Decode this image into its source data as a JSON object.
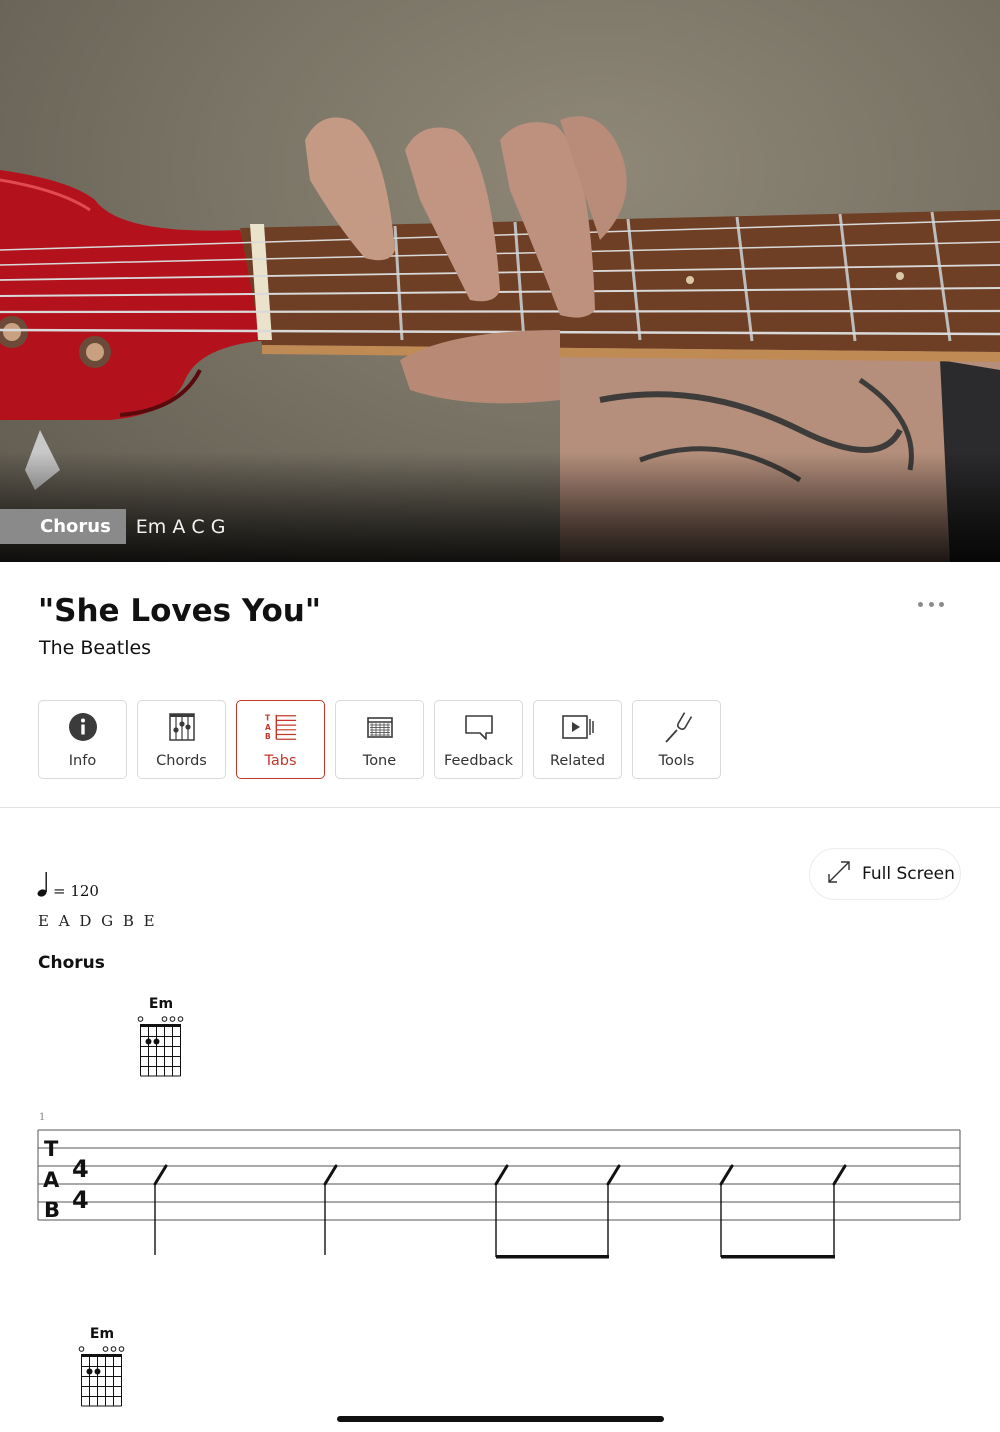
{
  "video": {
    "section_label": "Chorus",
    "section_chords": "Em A C G"
  },
  "song": {
    "title": "\"She Loves You\"",
    "artist": "The Beatles"
  },
  "toolbar": {
    "more_icon": "ellipsis-icon",
    "tabs": [
      {
        "label": "Info",
        "icon": "info-icon",
        "active": false
      },
      {
        "label": "Chords",
        "icon": "chord-grid-icon",
        "active": false
      },
      {
        "label": "Tabs",
        "icon": "tab-icon",
        "active": true
      },
      {
        "label": "Tone",
        "icon": "amp-icon",
        "active": false
      },
      {
        "label": "Feedback",
        "icon": "speech-bubble-icon",
        "active": false
      },
      {
        "label": "Related",
        "icon": "video-play-icon",
        "active": false
      },
      {
        "label": "Tools",
        "icon": "tuning-fork-icon",
        "active": false
      }
    ],
    "accent_color": "#c0392b"
  },
  "notation": {
    "fullscreen_label": "Full Screen",
    "tempo_value": "= 120",
    "tuning": "E A D G B E",
    "section": "Chorus",
    "measure_number": "1",
    "tab_letters": [
      "T",
      "A",
      "B"
    ],
    "time_signature": [
      "4",
      "4"
    ],
    "chords": [
      {
        "name": "Em",
        "open_strings": "o ooo"
      },
      {
        "name": "Em",
        "open_strings": "o ooo"
      }
    ]
  }
}
